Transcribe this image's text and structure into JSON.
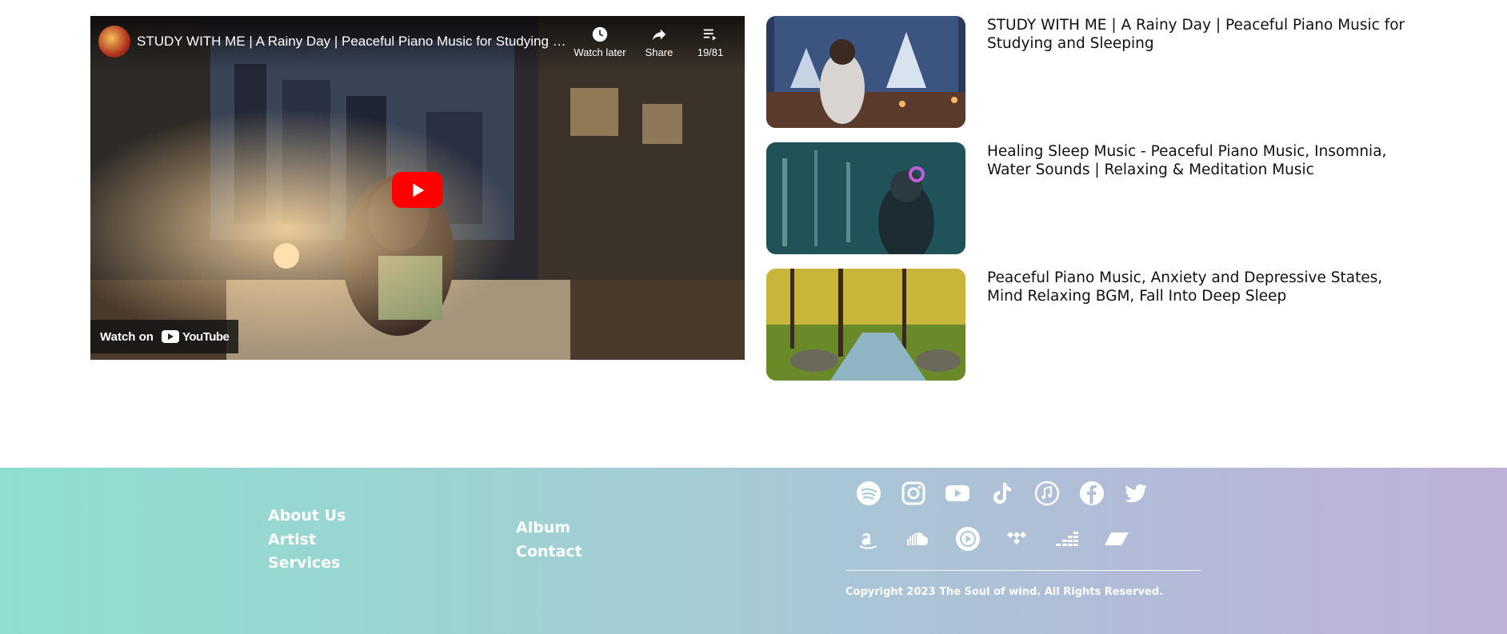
{
  "player": {
    "video_title": "STUDY WITH ME | A Rainy Day | Peaceful Piano Music for Studying an...",
    "controls": [
      {
        "label": "Watch later",
        "icon": "clock-icon"
      },
      {
        "label": "Share",
        "icon": "share-icon"
      },
      {
        "label": "19/81",
        "icon": "playlist-icon"
      }
    ],
    "watch_on_label": "Watch on",
    "youtube_label": "YouTube"
  },
  "related": [
    {
      "title": "STUDY WITH ME | A Rainy Day | Peaceful Piano Music for Studying and Sleeping"
    },
    {
      "title": "Healing Sleep Music - Peaceful Piano Music, Insomnia, Water Sounds | Relaxing & Meditation Music"
    },
    {
      "title": "Peaceful Piano Music, Anxiety and Depressive States, Mind Relaxing BGM, Fall Into Deep Sleep"
    }
  ],
  "footer": {
    "nav_col1": [
      "About Us",
      "Artist",
      "Services"
    ],
    "nav_col2": [
      "Album",
      "Contact"
    ],
    "social_row1": [
      "spotify-icon",
      "instagram-icon",
      "youtube-icon",
      "tiktok-icon",
      "apple-music-icon",
      "facebook-icon",
      "twitter-icon"
    ],
    "social_row2": [
      "amazon-music-icon",
      "soundcloud-icon",
      "youtube-music-icon",
      "tidal-icon",
      "deezer-icon",
      "napster-icon"
    ],
    "copyright": "Copyright 2023 The Soul of wind. All Rights Reserved."
  },
  "colors": {
    "footer_gradient_start": "#8edfcf",
    "footer_gradient_end": "#bfb1d9",
    "play_button": "#ff0000"
  }
}
